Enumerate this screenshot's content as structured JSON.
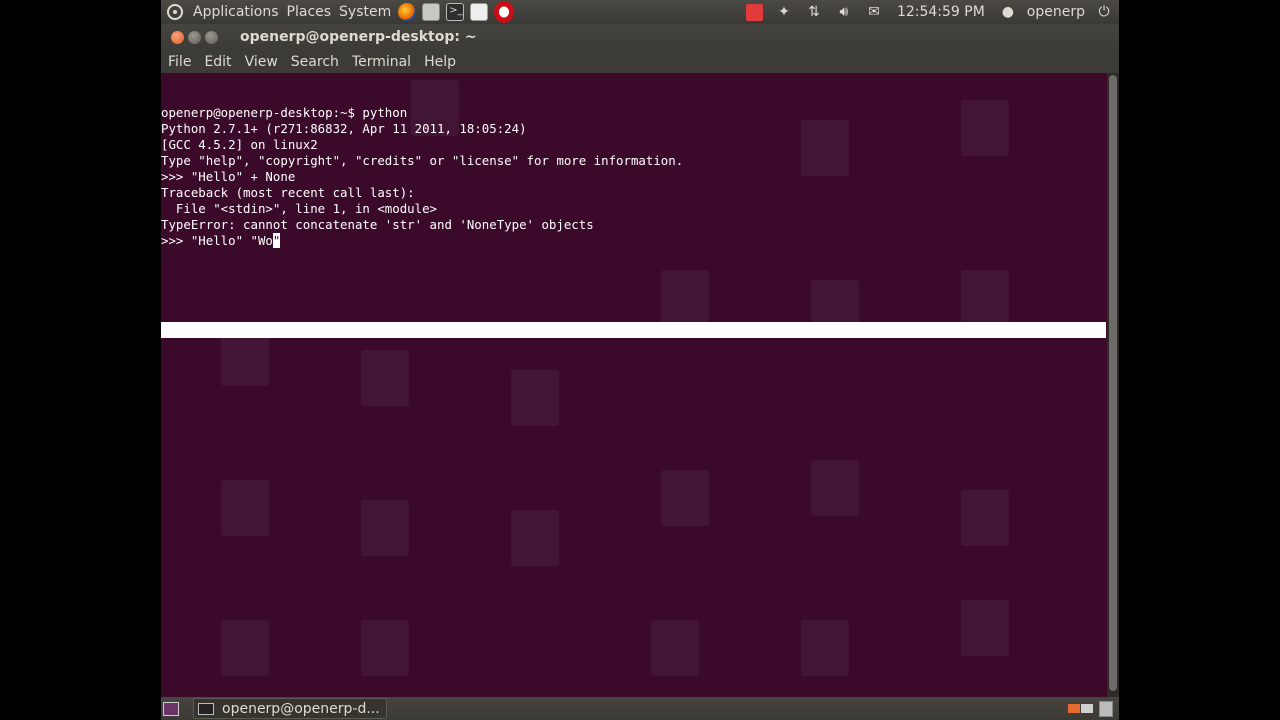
{
  "top_panel": {
    "menus": [
      "Applications",
      "Places",
      "System"
    ],
    "clock": "12:54:59 PM",
    "user": "openerp",
    "launchers": [
      "firefox-icon",
      "calculator-icon",
      "terminal-icon",
      "text-editor-icon",
      "opera-icon"
    ]
  },
  "window": {
    "title": "openerp@openerp-desktop: ~",
    "menu": [
      "File",
      "Edit",
      "View",
      "Search",
      "Terminal",
      "Help"
    ]
  },
  "terminal": {
    "lines": [
      "openerp@openerp-desktop:~$ python",
      "Python 2.7.1+ (r271:86832, Apr 11 2011, 18:05:24)",
      "[GCC 4.5.2] on linux2",
      "Type \"help\", \"copyright\", \"credits\" or \"license\" for more information.",
      ">>> \"Hello\" + None",
      "Traceback (most recent call last):",
      "  File \"<stdin>\", line 1, in <module>",
      "TypeError: cannot concatenate 'str' and 'NoneType' objects"
    ],
    "prompt_line": ">>> \"Hello\" \"Wo",
    "cursor_char": "\""
  },
  "bottom_panel": {
    "task": "openerp@openerp-d..."
  },
  "colors": {
    "terminal_bg": "#3b0a2a",
    "panel_bg": "#3c3b37",
    "close_button": "#e25b22"
  }
}
